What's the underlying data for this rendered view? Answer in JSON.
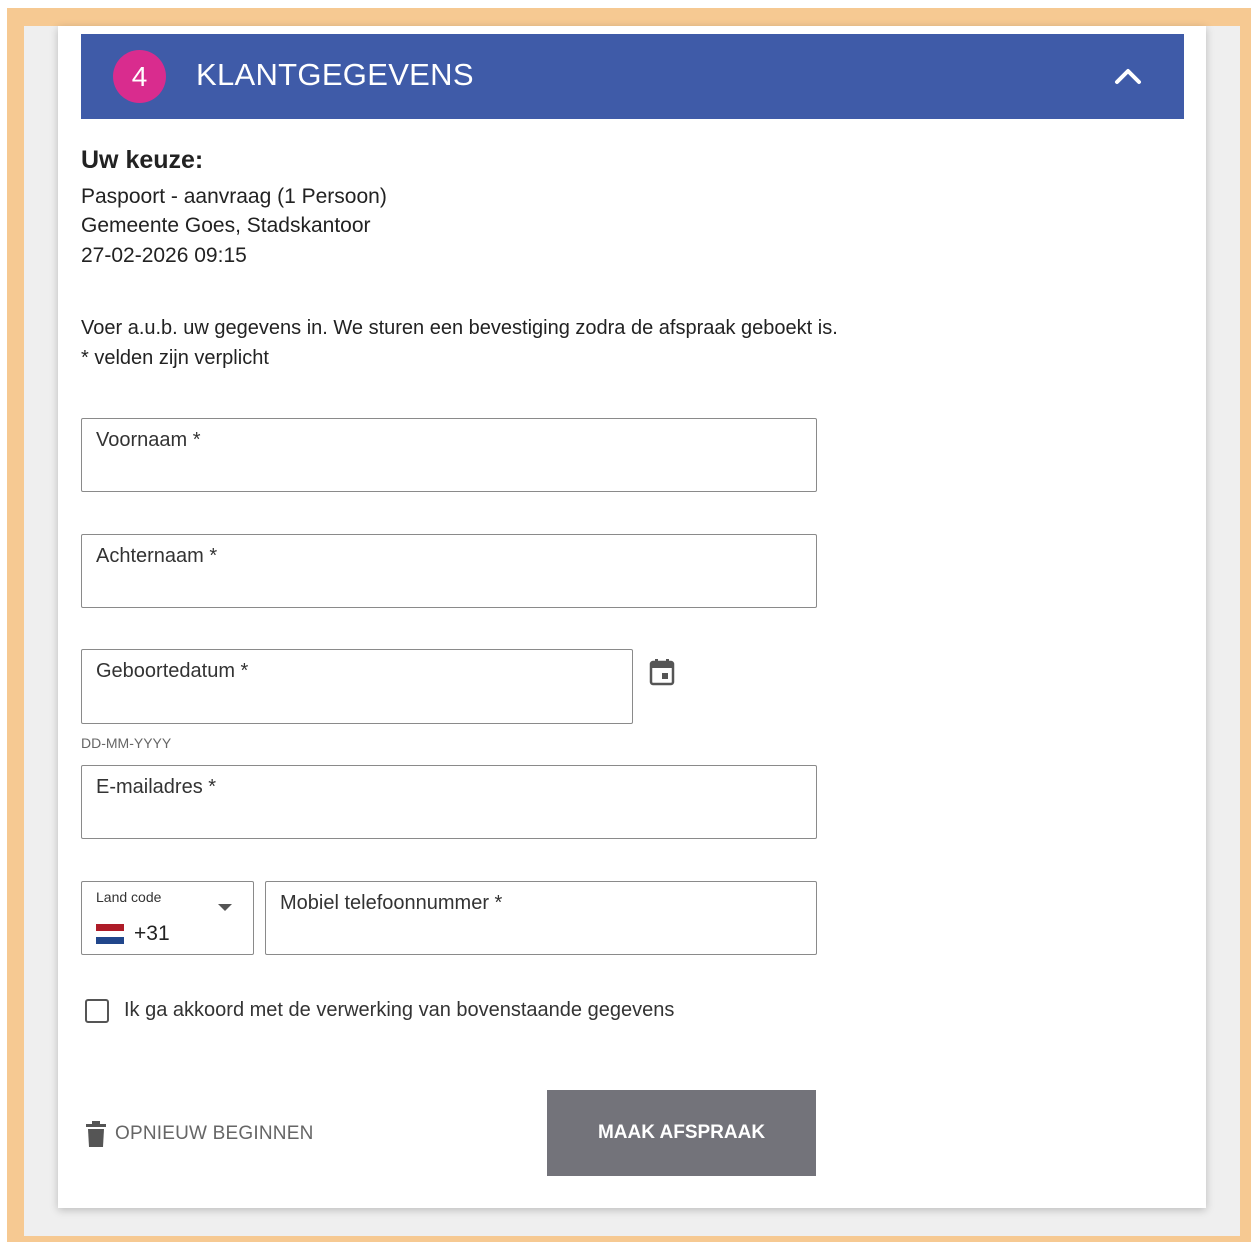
{
  "header": {
    "step_number": "4",
    "title": "KLANTGEGEVENS",
    "collapse_icon": "chevron-up-icon",
    "color": "#3f5ba8",
    "badge_color": "#d92c8e"
  },
  "summary": {
    "heading": "Uw keuze:",
    "product": "Paspoort - aanvraag (1 Persoon)",
    "location": "Gemeente Goes, Stadskantoor",
    "datetime": "27-02-2026 09:15"
  },
  "instructions": {
    "line1": "Voer a.u.b. uw gegevens in. We sturen een bevestiging zodra de afspraak geboekt is.",
    "line2": "* velden zijn verplicht"
  },
  "form": {
    "voornaam_label": "Voornaam *",
    "achternaam_label": "Achternaam *",
    "geboortedatum_label": "Geboortedatum *",
    "geboortedatum_hint": "DD-MM-YYYY",
    "calendar_icon": "calendar-icon",
    "email_label": "E-mailadres *",
    "land_code_label": "Land code",
    "land_code_value": "+31",
    "land_code_flag": "netherlands-flag-icon",
    "telefoon_label": "Mobiel telefoonnummer *",
    "consent_label": "Ik ga akkoord met de verwerking van bovenstaande gegevens",
    "consent_checked": false
  },
  "actions": {
    "reset_label": "OPNIEUW BEGINNEN",
    "reset_icon": "trash-icon",
    "submit_label": "MAAK AFSPRAAK",
    "submit_color": "#73737a"
  }
}
